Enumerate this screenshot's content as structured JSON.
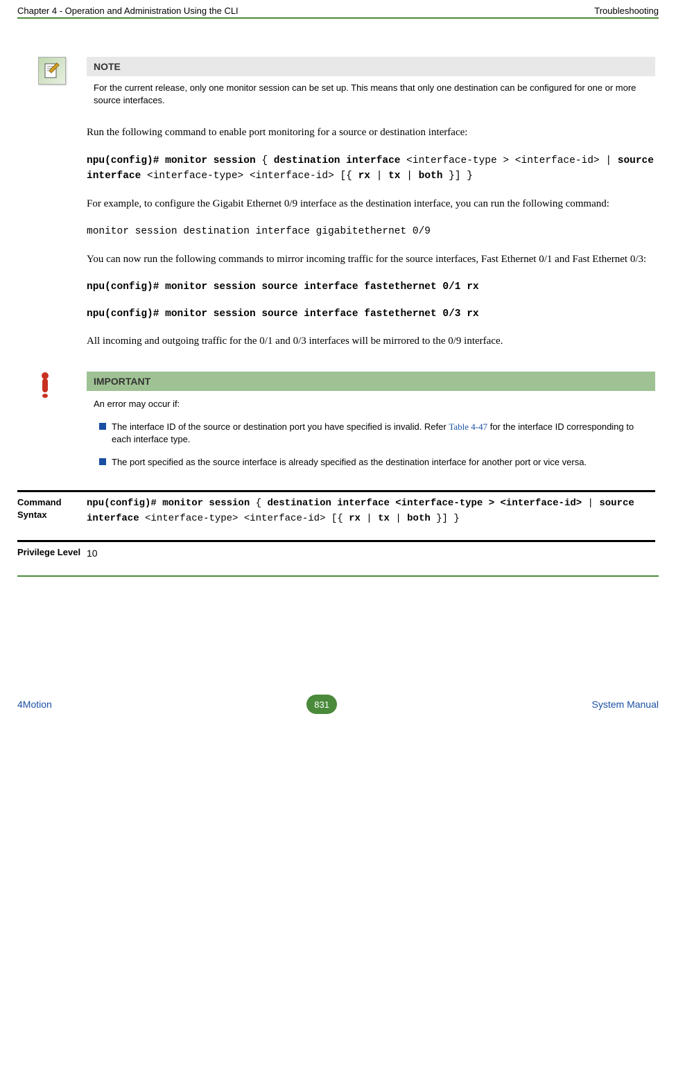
{
  "header": {
    "left": "Chapter 4 - Operation and Administration Using the CLI",
    "right": "Troubleshooting"
  },
  "note": {
    "title": "NOTE",
    "body": "For the current release, only one monitor session can be set up. This means that only one destination can be configured for one or more source interfaces."
  },
  "para1": "Run the following command to enable port monitoring for a source or destination interface:",
  "code1_parts": {
    "a": "npu(config)# monitor session",
    "b": " { ",
    "c": "destination interface",
    "d": " <interface-type > <interface-id> | ",
    "e": "source interface",
    "f": " <interface-type> <interface-id> [{ ",
    "g": "rx",
    "h": " | ",
    "i": "tx",
    "j": " | ",
    "k": "both",
    "l": " }] }"
  },
  "para2": "For example, to configure the Gigabit Ethernet 0/9 interface as the destination interface, you can run the following command:",
  "code2": "monitor session destination interface gigabitethernet 0/9",
  "para3": "You can now run the following commands to mirror incoming traffic for the source interfaces, Fast Ethernet 0/1 and Fast Ethernet 0/3:",
  "code3": "npu(config)# monitor session source interface fastethernet 0/1 rx",
  "code4": "npu(config)# monitor session source interface fastethernet 0/3 rx",
  "para4": "All incoming and outgoing traffic for the 0/1 and 0/3 interfaces will be mirrored to the 0/9 interface.",
  "important": {
    "title": "IMPORTANT",
    "intro": "An error may occur if:",
    "bullet1_a": "The interface ID of the source or destination port you have specified is invalid. Refer ",
    "bullet1_link": "Table 4-47",
    "bullet1_b": " for the interface ID corresponding to each interface type.",
    "bullet2": "The port specified as the source interface is already specified as the destination interface for another port or vice versa."
  },
  "cmd_syntax": {
    "label": "Command Syntax",
    "parts": {
      "a": "npu(config)# monitor session",
      "b": " { ",
      "c": "destination interface <interface-type > <interface-id>",
      "d": " | ",
      "e": "source interface",
      "f": " <interface-type> <interface-id> [{ ",
      "g": "rx",
      "h": " | ",
      "i": "tx",
      "j": " | ",
      "k": "both",
      "l": " }] }"
    }
  },
  "priv_level": {
    "label": "Privilege Level",
    "value": "10"
  },
  "footer": {
    "left": "4Motion",
    "page": "831",
    "right": "System Manual"
  }
}
